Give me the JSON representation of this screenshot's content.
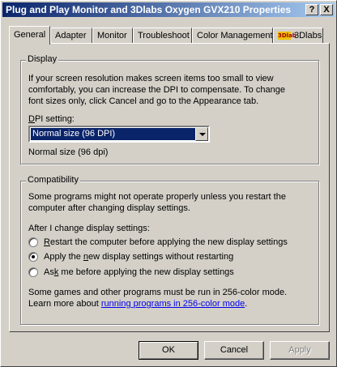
{
  "window": {
    "title": "Plug and Play Monitor and 3Dlabs Oxygen GVX210 Properties",
    "help_button": "?",
    "close_button": "X"
  },
  "tabs": [
    {
      "label": "General",
      "active": true
    },
    {
      "label": "Adapter"
    },
    {
      "label": "Monitor"
    },
    {
      "label": "Troubleshoot"
    },
    {
      "label": "Color Management"
    },
    {
      "label": "3Dlabs",
      "icon": "3dlabs-logo-icon",
      "logo_text": "3Dlab"
    }
  ],
  "display": {
    "legend": "Display",
    "description_line1": "If your screen resolution makes screen items too small to view",
    "description_line2": "comfortably, you can increase the DPI to compensate.  To change",
    "description_line3": "font sizes only, click Cancel and go to the Appearance tab.",
    "dpi_label_first": "D",
    "dpi_label_rest": "PI setting:",
    "dpi_selected": "Normal size (96 DPI)",
    "dpi_status": "Normal size (96 dpi)"
  },
  "compatibility": {
    "legend": "Compatibility",
    "description_line1": "Some programs might not operate properly unless you restart the",
    "description_line2": "computer after changing display settings.",
    "after_change_label": "After I change display settings:",
    "options": [
      {
        "first": "R",
        "rest": "estart the computer before applying the new display settings",
        "selected": false
      },
      {
        "first": "Apply the ",
        "mid": "n",
        "rest": "ew display settings without restarting",
        "selected": true
      },
      {
        "first": "As",
        "mid": "k",
        "rest": " me before applying the new display settings",
        "selected": false
      }
    ],
    "games_line1": "Some games and other programs must be run in 256-color mode.",
    "games_line2_prefix": "Learn more about ",
    "games_link": "running programs in 256-color mode",
    "games_line2_suffix": "."
  },
  "buttons": {
    "ok": "OK",
    "cancel": "Cancel",
    "apply": "Apply"
  },
  "colors": {
    "face": "#d4d0c8",
    "title_start": "#0a246a",
    "title_end": "#a6caf0",
    "selection": "#0a246a",
    "link": "#0000ee"
  }
}
